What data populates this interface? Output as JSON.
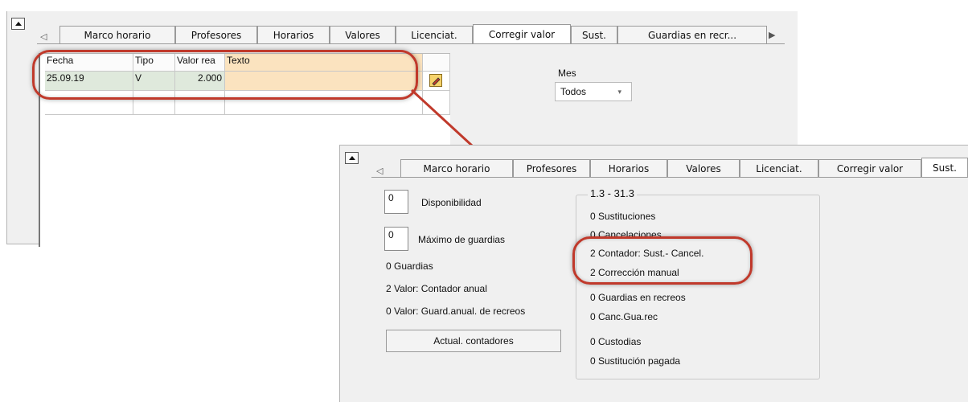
{
  "tabs": [
    "Marco horario",
    "Profesores",
    "Horarios",
    "Valores",
    "Licenciat.",
    "Corregir valor",
    "Sust.",
    "Guardias en recr..."
  ],
  "tabs_front": [
    "Marco horario",
    "Profesores",
    "Horarios",
    "Valores",
    "Licenciat.",
    "Corregir valor",
    "Sust."
  ],
  "grid": {
    "headers": [
      "Fecha",
      "Tipo",
      "Valor rea",
      "Texto"
    ],
    "row": {
      "fecha": "25.09.19",
      "tipo": "V",
      "valor": "2.000",
      "texto": ""
    }
  },
  "mes": {
    "label": "Mes",
    "value": "Todos"
  },
  "counters": {
    "disponibilidad_value": "0",
    "disponibilidad_label": "Disponibilidad",
    "max_guardias_value": "0",
    "max_guardias_label": "Máximo de guardias",
    "guardias": "0 Guardias",
    "valor_contador_anual": "2 Valor: Contador anual",
    "valor_guard_anual": "0  Valor: Guard.anual. de recreos",
    "actual_button": "Actual. contadores"
  },
  "period": {
    "title": "1.3 - 31.3",
    "sustituciones": "0 Sustituciones",
    "cancelaciones": "0 Cancelaciones",
    "contador": "2 Contador: Sust.- Cancel.",
    "correccion": "2 Corrección manual",
    "guardias_recreos": "0 Guardias en recreos",
    "canc_gua_rec": "0 Canc.Gua.rec",
    "custodias": "0 Custodias",
    "sustitucion_pagada": "0 Sustitución pagada"
  },
  "colors": {
    "highlight": "#c0392b",
    "header_highlight": "#fbe3bf",
    "selected_row": "#dfe9dc"
  },
  "icons": [
    "collapse-up-icon",
    "tab-scroll-left-icon",
    "tab-scroll-right-icon",
    "edit-pencil-icon",
    "dropdown-arrow-icon"
  ]
}
